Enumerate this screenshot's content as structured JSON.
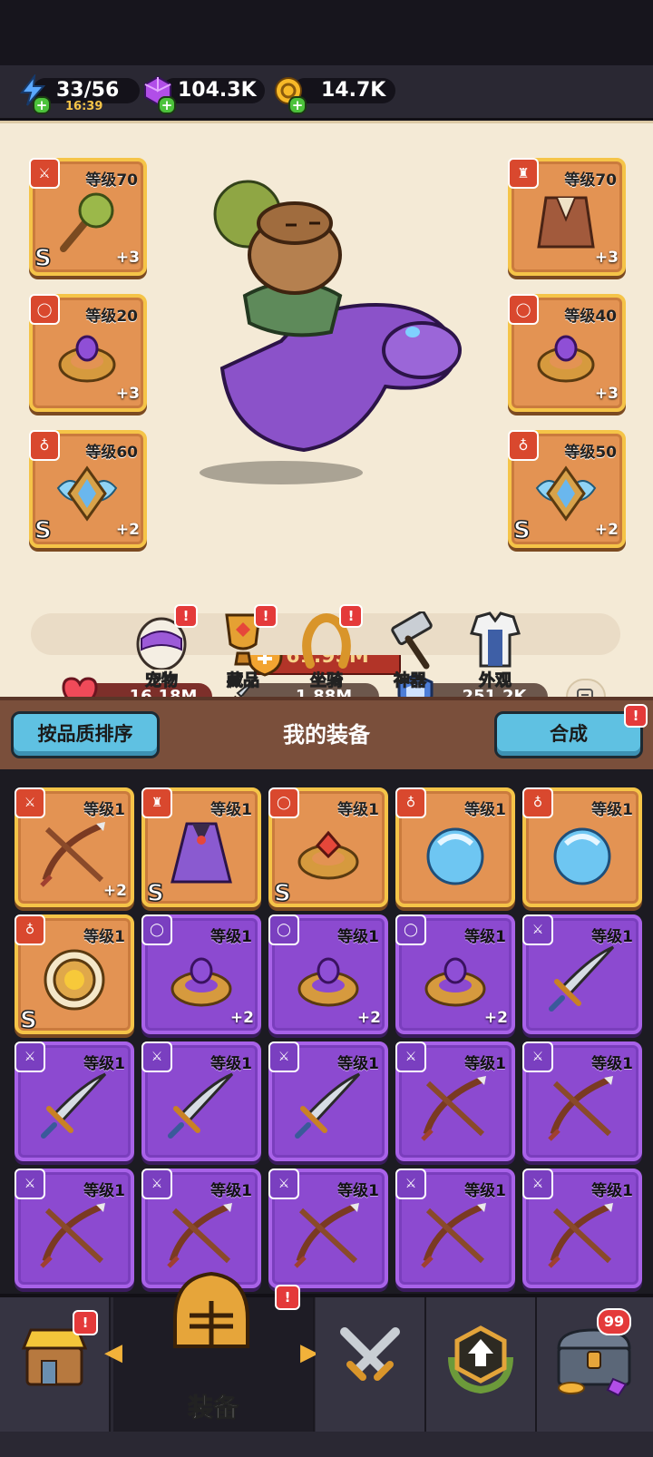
{
  "resources": {
    "energy": {
      "value": "33/56",
      "timer": "16:39",
      "icon": "lightning-icon"
    },
    "gems": {
      "value": "104.3K",
      "icon": "purple-gem-icon"
    },
    "coins": {
      "value": "14.7K",
      "icon": "gold-coin-icon"
    }
  },
  "hero": {
    "equipped_left": [
      {
        "level": "等级70",
        "plus": "+3",
        "grade": "S",
        "type_icon": "weapon-icon",
        "item": "spiked-club"
      },
      {
        "level": "等级20",
        "plus": "+3",
        "grade": "",
        "type_icon": "ring-icon",
        "item": "gold-ring"
      },
      {
        "level": "等级60",
        "plus": "+2",
        "grade": "S",
        "type_icon": "necklace-icon",
        "item": "winged-amulet"
      }
    ],
    "equipped_right": [
      {
        "level": "等级70",
        "plus": "+3",
        "grade": "",
        "type_icon": "armor-icon",
        "item": "leather-armor"
      },
      {
        "level": "等级40",
        "plus": "+3",
        "grade": "",
        "type_icon": "ring-icon",
        "item": "gold-ring"
      },
      {
        "level": "等级50",
        "plus": "+2",
        "grade": "S",
        "type_icon": "necklace-icon",
        "item": "winged-amulet"
      }
    ],
    "power": "61.95M",
    "stats": {
      "hp": "16.18M",
      "attack": "1.88M",
      "defense": "251.2K"
    }
  },
  "tools": [
    {
      "label": "宠物",
      "badge": "!",
      "icon": "pet-egg-icon"
    },
    {
      "label": "藏品",
      "badge": "!",
      "icon": "trophy-icon"
    },
    {
      "label": "坐骑",
      "badge": "!",
      "icon": "horseshoe-icon"
    },
    {
      "label": "神器",
      "badge": "",
      "icon": "hammer-icon"
    },
    {
      "label": "外观",
      "badge": "",
      "icon": "outfit-icon"
    }
  ],
  "bag": {
    "sort_label": "按品质排序",
    "title": "我的装备",
    "merge_label": "合成",
    "merge_badge": "!"
  },
  "items": [
    {
      "level": "等级1",
      "plus": "+2",
      "grade": "",
      "rarity": "orange",
      "type_icon": "weapon-icon",
      "item": "crossbow"
    },
    {
      "level": "等级1",
      "plus": "",
      "grade": "S",
      "rarity": "orange",
      "type_icon": "armor-icon",
      "item": "cloak"
    },
    {
      "level": "等级1",
      "plus": "",
      "grade": "S",
      "rarity": "orange",
      "type_icon": "ring-icon",
      "item": "ruby-ring"
    },
    {
      "level": "等级1",
      "plus": "",
      "grade": "",
      "rarity": "orange",
      "type_icon": "necklace-icon",
      "item": "water-orb"
    },
    {
      "level": "等级1",
      "plus": "",
      "grade": "",
      "rarity": "orange",
      "type_icon": "necklace-icon",
      "item": "water-orb"
    },
    {
      "level": "等级1",
      "plus": "",
      "grade": "S",
      "rarity": "orange",
      "type_icon": "necklace-icon",
      "item": "sun-amulet"
    },
    {
      "level": "等级1",
      "plus": "+2",
      "grade": "",
      "rarity": "purple",
      "type_icon": "ring-icon",
      "item": "gold-ring"
    },
    {
      "level": "等级1",
      "plus": "+2",
      "grade": "",
      "rarity": "purple",
      "type_icon": "ring-icon",
      "item": "gold-ring"
    },
    {
      "level": "等级1",
      "plus": "+2",
      "grade": "",
      "rarity": "purple",
      "type_icon": "ring-icon",
      "item": "gold-ring"
    },
    {
      "level": "等级1",
      "plus": "",
      "grade": "",
      "rarity": "purple",
      "type_icon": "weapon-icon",
      "item": "sword"
    },
    {
      "level": "等级1",
      "plus": "",
      "grade": "",
      "rarity": "purple",
      "type_icon": "weapon-icon",
      "item": "sword"
    },
    {
      "level": "等级1",
      "plus": "",
      "grade": "",
      "rarity": "purple",
      "type_icon": "weapon-icon",
      "item": "sword"
    },
    {
      "level": "等级1",
      "plus": "",
      "grade": "",
      "rarity": "purple",
      "type_icon": "weapon-icon",
      "item": "sword"
    },
    {
      "level": "等级1",
      "plus": "",
      "grade": "",
      "rarity": "purple",
      "type_icon": "weapon-icon",
      "item": "crossbow"
    },
    {
      "level": "等级1",
      "plus": "",
      "grade": "",
      "rarity": "purple",
      "type_icon": "weapon-icon",
      "item": "crossbow"
    },
    {
      "level": "等级1",
      "plus": "",
      "grade": "",
      "rarity": "purple",
      "type_icon": "weapon-icon",
      "item": "crossbow"
    },
    {
      "level": "等级1",
      "plus": "",
      "grade": "",
      "rarity": "purple",
      "type_icon": "weapon-icon",
      "item": "crossbow"
    },
    {
      "level": "等级1",
      "plus": "",
      "grade": "",
      "rarity": "purple",
      "type_icon": "weapon-icon",
      "item": "crossbow"
    },
    {
      "level": "等级1",
      "plus": "",
      "grade": "",
      "rarity": "purple",
      "type_icon": "weapon-icon",
      "item": "crossbow"
    },
    {
      "level": "等级1",
      "plus": "",
      "grade": "",
      "rarity": "purple",
      "type_icon": "weapon-icon",
      "item": "crossbow"
    }
  ],
  "nav": {
    "tabs": [
      {
        "name": "shop",
        "icon": "shop-icon",
        "badge": "!"
      },
      {
        "name": "equipment",
        "icon": "helmet-icon",
        "badge": "!",
        "label": "装备",
        "active": true
      },
      {
        "name": "battle",
        "icon": "crossed-swords-icon",
        "badge": ""
      },
      {
        "name": "upgrade",
        "icon": "upgrade-arrow-icon",
        "badge": ""
      },
      {
        "name": "chest",
        "icon": "treasure-chest-icon",
        "badge": "99"
      }
    ]
  },
  "colors": {
    "orange_rarity": "#e39353",
    "purple_rarity": "#8c4ad0",
    "accent_blue": "#5fc1e2",
    "badge_red": "#e43a3a"
  }
}
